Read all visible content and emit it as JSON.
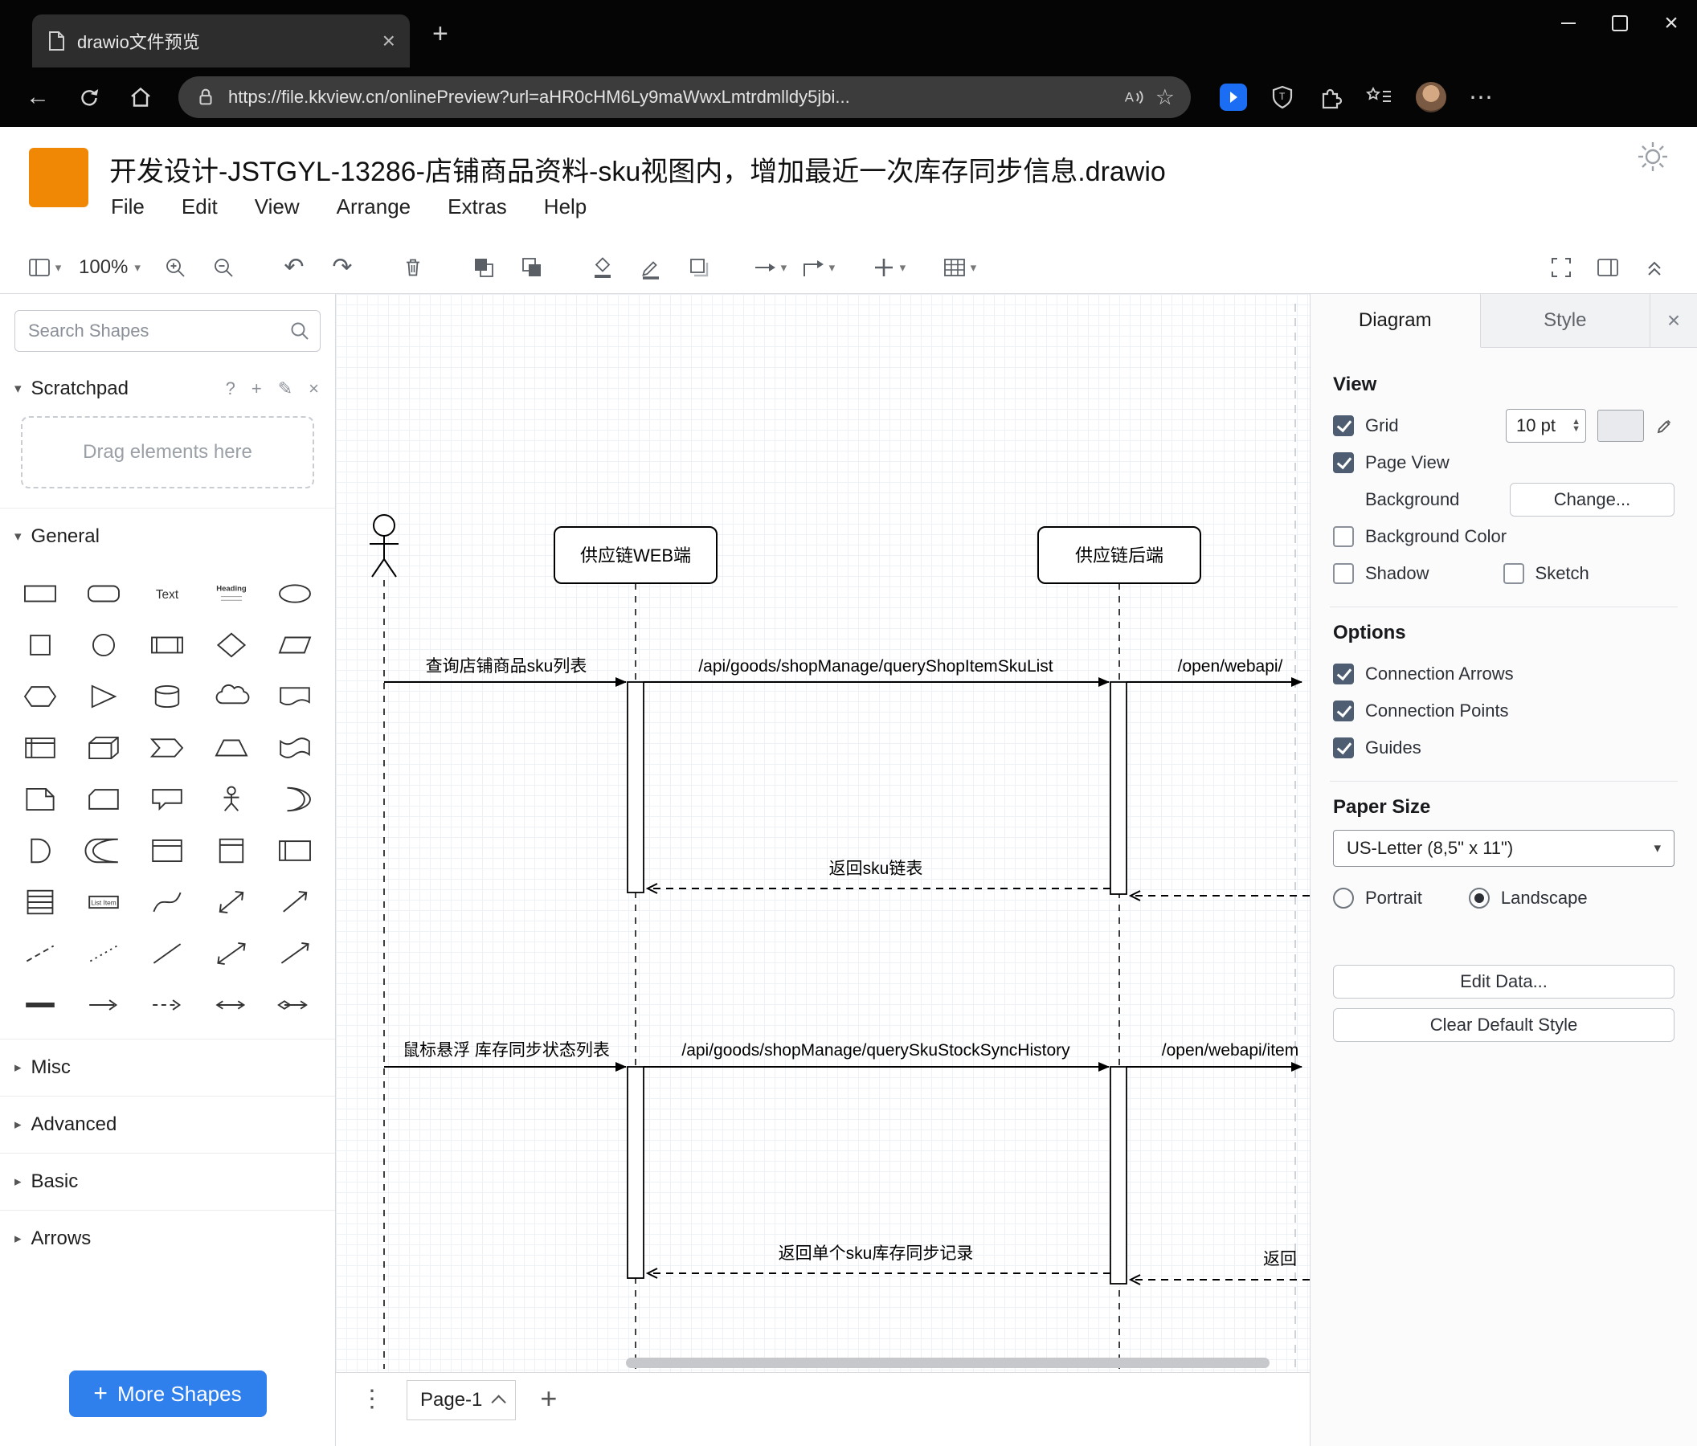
{
  "browser": {
    "tab_title": "drawio文件预览",
    "url": "https://file.kkview.cn/onlinePreview?url=aHR0cHM6Ly9maWwxLmtrdmlldy5jbi...",
    "read_aloud": "A"
  },
  "app": {
    "title": "开发设计-JSTGYL-13286-店铺商品资料-sku视图内，增加最近一次库存同步信息.drawio",
    "menus": [
      "File",
      "Edit",
      "View",
      "Arrange",
      "Extras",
      "Help"
    ],
    "zoom": "100%"
  },
  "sidebar": {
    "search_placeholder": "Search Shapes",
    "scratchpad_title": "Scratchpad",
    "scratchpad_hint": "Drag elements here",
    "sections": [
      "General",
      "Misc",
      "Advanced",
      "Basic",
      "Arrows"
    ],
    "more_shapes_label": "More Shapes",
    "text_label": "Text",
    "heading_label": "Heading",
    "list_item_label": "List Item",
    "shapes": [
      "rectangle",
      "rounded-rectangle",
      "text",
      "textbox",
      "ellipse",
      "square",
      "circle",
      "process",
      "diamond",
      "parallelogram",
      "hexagon",
      "triangle",
      "cylinder",
      "cloud",
      "document",
      "internal-storage",
      "cube",
      "step",
      "trapezoid",
      "tape",
      "note",
      "card",
      "callout",
      "actor",
      "or",
      "and",
      "data-storage",
      "container",
      "vertical-container",
      "horizontal-container",
      "list",
      "list-item",
      "curve",
      "bidirectional-arrow",
      "arrow",
      "dashed-line",
      "dotted-line",
      "line",
      "bidirectional-connector",
      "directional-connector",
      "link",
      "directional-edge",
      "dashed-edge",
      "labeled-edge",
      "diamond-edge"
    ]
  },
  "canvas": {
    "participants": [
      "供应链WEB端",
      "供应链后端"
    ],
    "messages": {
      "m1": "查询店铺商品sku列表",
      "m2": "/api/goods/shopManage/queryShopItemSkuList",
      "m3": "/open/webapi/",
      "r1": "返回sku链表",
      "m4": "鼠标悬浮 库存同步状态列表",
      "m5": "/api/goods/shopManage/querySkuStockSyncHistory",
      "m6": "/open/webapi/item",
      "r2": "返回单个sku库存同步记录",
      "r3": "返回"
    }
  },
  "footer": {
    "page_tab": "Page-1"
  },
  "format": {
    "tabs": {
      "diagram": "Diagram",
      "style": "Style"
    },
    "view": {
      "heading": "View",
      "grid": "Grid",
      "grid_size": "10 pt",
      "page_view": "Page View",
      "background": "Background",
      "change": "Change...",
      "background_color": "Background Color",
      "shadow": "Shadow",
      "sketch": "Sketch",
      "grid_checked": true,
      "page_view_checked": true,
      "background_color_checked": false,
      "shadow_checked": false,
      "sketch_checked": false
    },
    "options": {
      "heading": "Options",
      "connection_arrows": "Connection Arrows",
      "connection_points": "Connection Points",
      "guides": "Guides",
      "connection_arrows_checked": true,
      "connection_points_checked": true,
      "guides_checked": true
    },
    "paper": {
      "heading": "Paper Size",
      "size": "US-Letter (8,5\" x 11\")",
      "portrait": "Portrait",
      "landscape": "Landscape",
      "orientation": "Landscape"
    },
    "edit_data": "Edit Data...",
    "clear_default_style": "Clear Default Style"
  }
}
